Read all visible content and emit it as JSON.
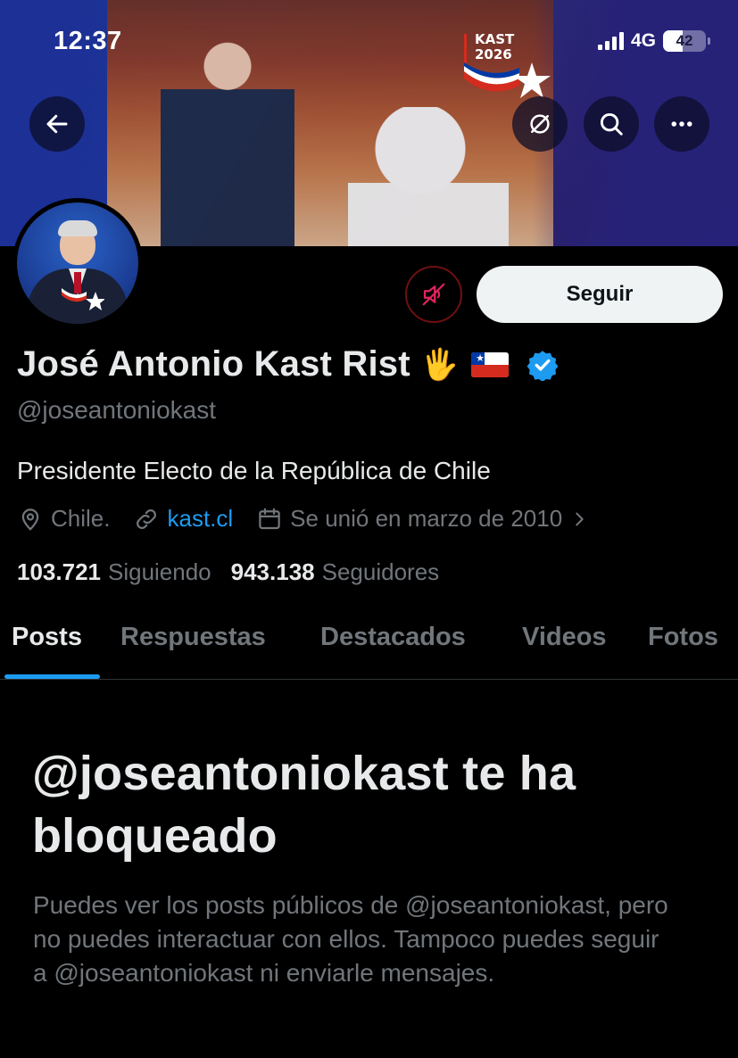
{
  "status_bar": {
    "time": "12:37",
    "network": "4G",
    "battery": "42"
  },
  "banner": {
    "brand_line1": "KAST",
    "brand_line2": "2026"
  },
  "header_buttons": {
    "back_icon": "arrow-left-icon",
    "grok_icon": "slash-circle-icon",
    "search_icon": "search-icon",
    "more_icon": "more-horizontal-icon"
  },
  "actions": {
    "follow_label": "Seguir",
    "mute_icon": "speaker-muted-icon"
  },
  "profile": {
    "name": "José Antonio Kast Rist",
    "emoji_hand": "🖐",
    "handle": "@joseantoniokast",
    "bio": "Presidente Electo de la República de Chile",
    "location": "Chile.",
    "website": "kast.cl",
    "joined": "Se unió en marzo de 2010",
    "following_count": "103.721",
    "following_label": "Siguiendo",
    "followers_count": "943.138",
    "followers_label": "Seguidores"
  },
  "tabs": [
    {
      "label": "Posts",
      "active": true
    },
    {
      "label": "Respuestas",
      "active": false
    },
    {
      "label": "Destacados",
      "active": false
    },
    {
      "label": "Videos",
      "active": false
    },
    {
      "label": "Fotos",
      "active": false
    }
  ],
  "blocked": {
    "title": "@joseantoniokast te ha bloqueado",
    "body": "Puedes ver los posts públicos de @joseantoniokast, pero no puedes interactuar con ellos. Tampoco puedes seguir a @joseantoniokast ni enviarle mensajes."
  },
  "colors": {
    "accent": "#1d9bf0",
    "background": "#000000",
    "muted_text": "#71767b",
    "primary_text": "#e7e9ea",
    "mute_border": "#6f1010",
    "mute_icon": "#e0245e"
  }
}
